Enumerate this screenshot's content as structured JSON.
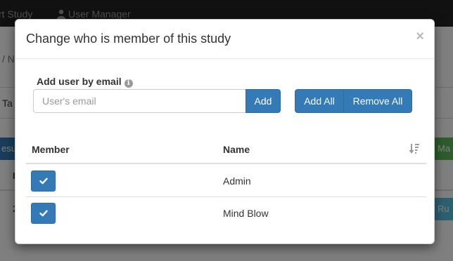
{
  "background": {
    "navbar": {
      "study_link": "rt Study",
      "user_manager_link": "User Manager"
    },
    "breadcrumb": "/ N",
    "tab_label": "Ta",
    "results_button": "esu",
    "manage_button": "Ma",
    "table_header_cell": "I",
    "row_cell": "2",
    "run_button": "Ru"
  },
  "modal": {
    "title": "Change who is member of this study",
    "close_symbol": "×",
    "add_user_label": "Add user by email",
    "info_icon_glyph": "i",
    "email_input": {
      "value": "",
      "placeholder": "User's email"
    },
    "add_button": "Add",
    "add_all_button": "Add All",
    "remove_all_button": "Remove All",
    "table": {
      "headers": {
        "member": "Member",
        "name": "Name"
      },
      "rows": [
        {
          "member": true,
          "name": "Admin"
        },
        {
          "member": true,
          "name": "Mind Blow"
        }
      ]
    }
  },
  "colors": {
    "primary": "#337ab7",
    "navbar": "#222222",
    "success": "#5cb85c",
    "info": "#5bc0de"
  },
  "icons": {
    "user": "user-icon",
    "info": "info-circle-icon",
    "close": "close-icon",
    "sort": "sort-amount-desc-icon",
    "check": "check-icon"
  }
}
